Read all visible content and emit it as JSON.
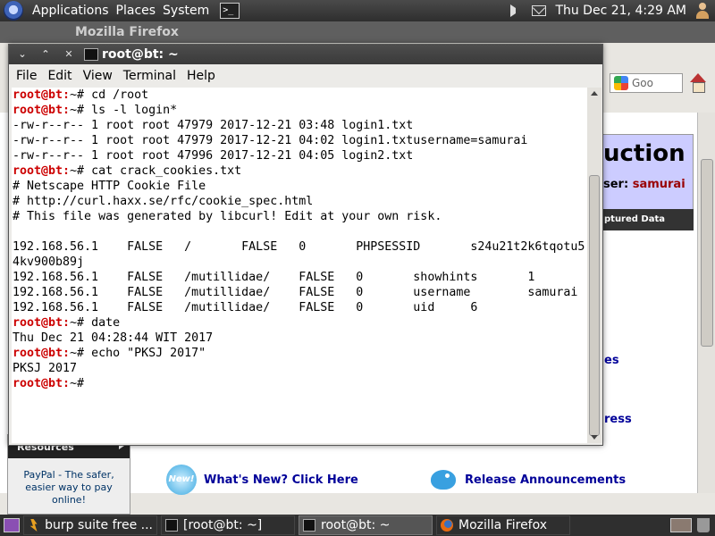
{
  "top_panel": {
    "menus": [
      "Applications",
      "Places",
      "System"
    ],
    "datetime": "Thu Dec 21,  4:29 AM"
  },
  "firefox": {
    "title": "Mozilla Firefox",
    "search_placeholder": "Goo",
    "heading_fragment": "uction",
    "user_label": "ser: ",
    "user_value": "samurai",
    "dark_bar": "ptured Data",
    "link_fragment_1": "es",
    "link_fragment_2": "ress",
    "sidebar_resources": "Resources",
    "paypal_text": "PayPal - The safer, easier way to pay online!",
    "new_badge": "New!",
    "whats_new": "What's New? Click Here",
    "release_announcements": "Release Announcements"
  },
  "terminal": {
    "title": "root@bt: ~",
    "menus": [
      "File",
      "Edit",
      "View",
      "Terminal",
      "Help"
    ],
    "prompt": "root@bt:~#",
    "lines": [
      {
        "prompt": true,
        "text": " cd /root"
      },
      {
        "prompt": true,
        "text": " ls -l login*"
      },
      {
        "prompt": false,
        "text": "-rw-r--r-- 1 root root 47979 2017-12-21 03:48 login1.txt"
      },
      {
        "prompt": false,
        "text": "-rw-r--r-- 1 root root 47979 2017-12-21 04:02 login1.txtusername=samurai"
      },
      {
        "prompt": false,
        "text": "-rw-r--r-- 1 root root 47996 2017-12-21 04:05 login2.txt"
      },
      {
        "prompt": true,
        "text": " cat crack_cookies.txt"
      },
      {
        "prompt": false,
        "text": "# Netscape HTTP Cookie File"
      },
      {
        "prompt": false,
        "text": "# http://curl.haxx.se/rfc/cookie_spec.html"
      },
      {
        "prompt": false,
        "text": "# This file was generated by libcurl! Edit at your own risk."
      },
      {
        "prompt": false,
        "text": ""
      },
      {
        "prompt": false,
        "text": "192.168.56.1    FALSE   /       FALSE   0       PHPSESSID       s24u21t2k6tqotu5"
      },
      {
        "prompt": false,
        "text": "4kv900b89j"
      },
      {
        "prompt": false,
        "text": "192.168.56.1    FALSE   /mutillidae/    FALSE   0       showhints       1"
      },
      {
        "prompt": false,
        "text": "192.168.56.1    FALSE   /mutillidae/    FALSE   0       username        samurai"
      },
      {
        "prompt": false,
        "text": "192.168.56.1    FALSE   /mutillidae/    FALSE   0       uid     6"
      },
      {
        "prompt": true,
        "text": " date"
      },
      {
        "prompt": false,
        "text": "Thu Dec 21 04:28:44 WIT 2017"
      },
      {
        "prompt": true,
        "text": " echo \"PKSJ 2017\""
      },
      {
        "prompt": false,
        "text": "PKSJ 2017"
      },
      {
        "prompt": true,
        "text": ""
      }
    ]
  },
  "taskbar": {
    "tasks": [
      {
        "label": "burp suite free ...",
        "icon": "burp-icon",
        "active": false
      },
      {
        "label": "[root@bt: ~]",
        "icon": "terminal-icon",
        "active": false
      },
      {
        "label": "root@bt: ~",
        "icon": "terminal-icon",
        "active": true
      },
      {
        "label": "Mozilla Firefox",
        "icon": "firefox-icon",
        "active": false
      }
    ]
  }
}
